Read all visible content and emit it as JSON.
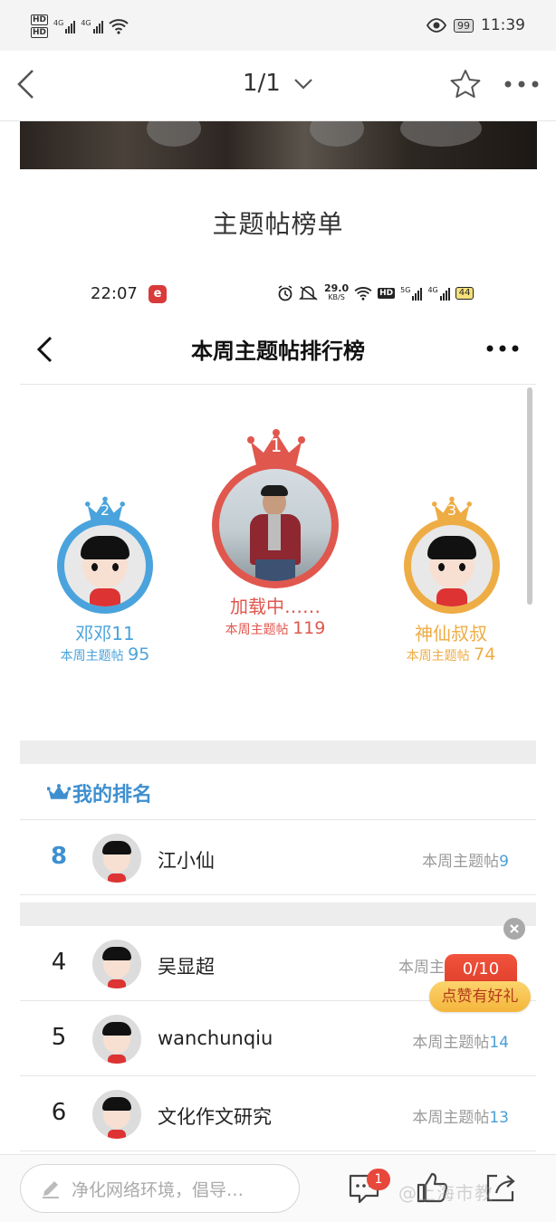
{
  "status_bar": {
    "hd1": "HD",
    "hd2": "HD",
    "net1": "4G",
    "net2": "4G",
    "battery": "99",
    "time": "11:39"
  },
  "nav": {
    "page_indicator": "1/1"
  },
  "document": {
    "title": "主题帖榜单"
  },
  "inner": {
    "status_bar": {
      "time": "22:07",
      "logo": "e",
      "speed": "29.0",
      "speed_unit": "KB/S",
      "hd": "HD",
      "net1": "5G",
      "net2": "4G",
      "battery": "44"
    },
    "title": "本周主题帖排行榜",
    "podium": [
      {
        "rank": "1",
        "name": "加载中……",
        "score_label": "本周主题帖",
        "score": "119",
        "color": "#e0574e"
      },
      {
        "rank": "2",
        "name": "邓邓11",
        "score_label": "本周主题帖",
        "score": "95",
        "color": "#4aa3dc"
      },
      {
        "rank": "3",
        "name": "神仙叔叔",
        "score_label": "本周主题帖",
        "score": "74",
        "color": "#eeac44"
      }
    ],
    "my_rank": {
      "heading": "我的排名",
      "rank": "8",
      "name": "江小仙",
      "score_label": "本周主题帖",
      "score": "9"
    },
    "rows": [
      {
        "rank": "4",
        "name": "吴显超",
        "score_label": "本周主",
        "score": ""
      },
      {
        "rank": "5",
        "name": "wanchunqiu",
        "score_label": "本周主题帖",
        "score": "14"
      },
      {
        "rank": "6",
        "name": "文化作文研究",
        "score_label": "本周主题帖",
        "score": "13"
      }
    ]
  },
  "promo": {
    "count": "0/10",
    "label": "点赞有好礼"
  },
  "bottom": {
    "placeholder": "净化网络环境，倡导…",
    "badge": "1",
    "watermark": "@上海市教"
  },
  "colors": {
    "accent": "#4a9fd6",
    "gold": "#eeac44",
    "red": "#e0574e"
  }
}
